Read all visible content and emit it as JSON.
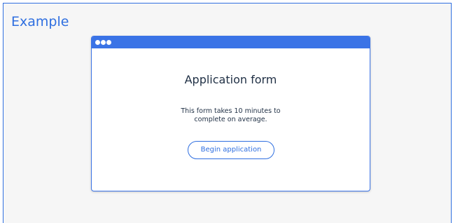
{
  "panel": {
    "label": "Example"
  },
  "browser": {
    "titlebar_color": "#3a73e6",
    "dots": [
      "window-dot",
      "window-dot",
      "window-dot"
    ]
  },
  "form": {
    "title": "Application form",
    "description": "This form takes 10 minutes to complete on average.",
    "button_label": "Begin application"
  },
  "colors": {
    "accent": "#2f6fe0",
    "panel_background": "#f6f6f6",
    "text": "#1f2f44"
  }
}
